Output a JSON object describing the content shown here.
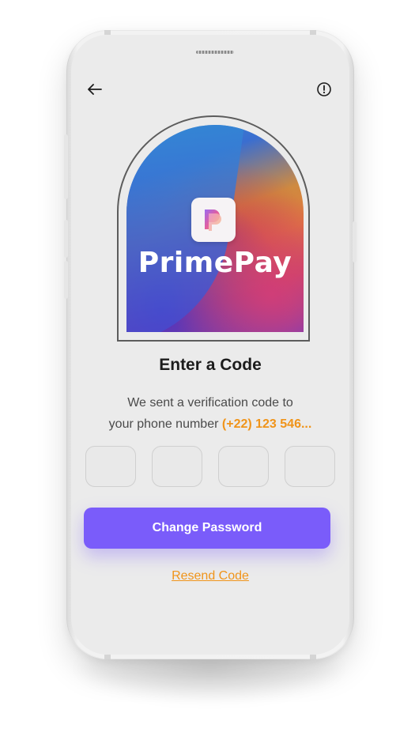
{
  "app": {
    "brand_name": "PrimePay",
    "accent_color": "#7a5cfa",
    "highlight_color": "#f0941a"
  },
  "header": {
    "back_icon": "arrow-left-icon",
    "info_icon": "alert-circle-icon"
  },
  "verification": {
    "title": "Enter a Code",
    "subtitle_line1": "We sent a verification code to",
    "subtitle_line2_prefix": "your phone number",
    "phone_number": "(+22) 123 546...",
    "code_digits": [
      "",
      "",
      "",
      ""
    ]
  },
  "actions": {
    "primary_label": "Change Password",
    "resend_label": "Resend Code"
  }
}
